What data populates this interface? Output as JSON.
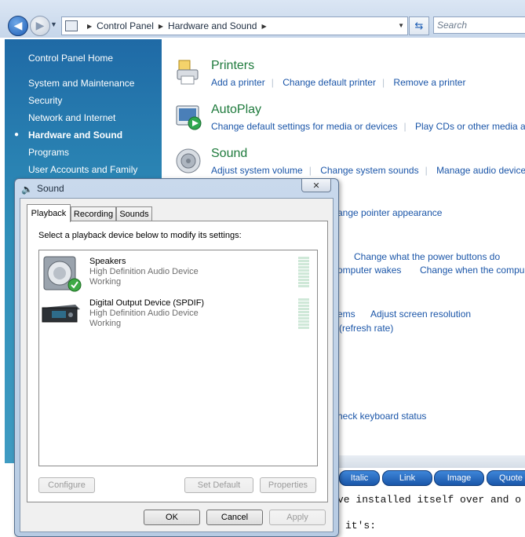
{
  "addressbar": {
    "crumbs": [
      "Control Panel",
      "Hardware and Sound"
    ],
    "search_placeholder": "Search"
  },
  "sidebar": {
    "home": "Control Panel Home",
    "items": [
      {
        "label": "System and Maintenance"
      },
      {
        "label": "Security"
      },
      {
        "label": "Network and Internet"
      },
      {
        "label": "Hardware and Sound"
      },
      {
        "label": "Programs"
      },
      {
        "label": "User Accounts and Family"
      }
    ]
  },
  "categories": {
    "printers": {
      "title": "Printers",
      "links": [
        "Add a printer",
        "Change default printer",
        "Remove a printer"
      ]
    },
    "autoplay": {
      "title": "AutoPlay",
      "links": [
        "Change default settings for media or devices",
        "Play CDs or other media au"
      ]
    },
    "sound": {
      "title": "Sound",
      "links": [
        "Adjust system volume",
        "Change system sounds",
        "Manage audio devices"
      ]
    }
  },
  "background_fragments": {
    "mouse": "ange pointer appearance",
    "power_1": "Change what the power buttons do",
    "power_2a": "omputer wakes",
    "power_2b": "Change when the compu",
    "display_1a": "ems",
    "display_1b": "Adjust screen resolution",
    "display_2": "(refresh rate)",
    "keyboard": "heck keyboard status"
  },
  "editor": {
    "buttons": [
      "Italic",
      "Link",
      "Image",
      "Quote"
    ],
    "line1": "ve installed itself over and o",
    "line2": "it's:"
  },
  "dialog": {
    "title": "Sound",
    "close_glyph": "✕",
    "tabs": [
      "Playback",
      "Recording",
      "Sounds"
    ],
    "instruction": "Select a playback device below to modify its settings:",
    "devices": [
      {
        "name": "Speakers",
        "description": "High Definition Audio Device",
        "status": "Working",
        "is_default": true
      },
      {
        "name": "Digital Output Device (SPDIF)",
        "description": "High Definition Audio Device",
        "status": "Working",
        "is_default": false
      }
    ],
    "buttons": {
      "configure": "Configure",
      "set_default": "Set Default",
      "properties": "Properties",
      "ok": "OK",
      "cancel": "Cancel",
      "apply": "Apply"
    }
  },
  "colors": {
    "sidebar": "#2f8fb9",
    "category_title": "#1e7a3c",
    "link": "#1a55a8"
  }
}
